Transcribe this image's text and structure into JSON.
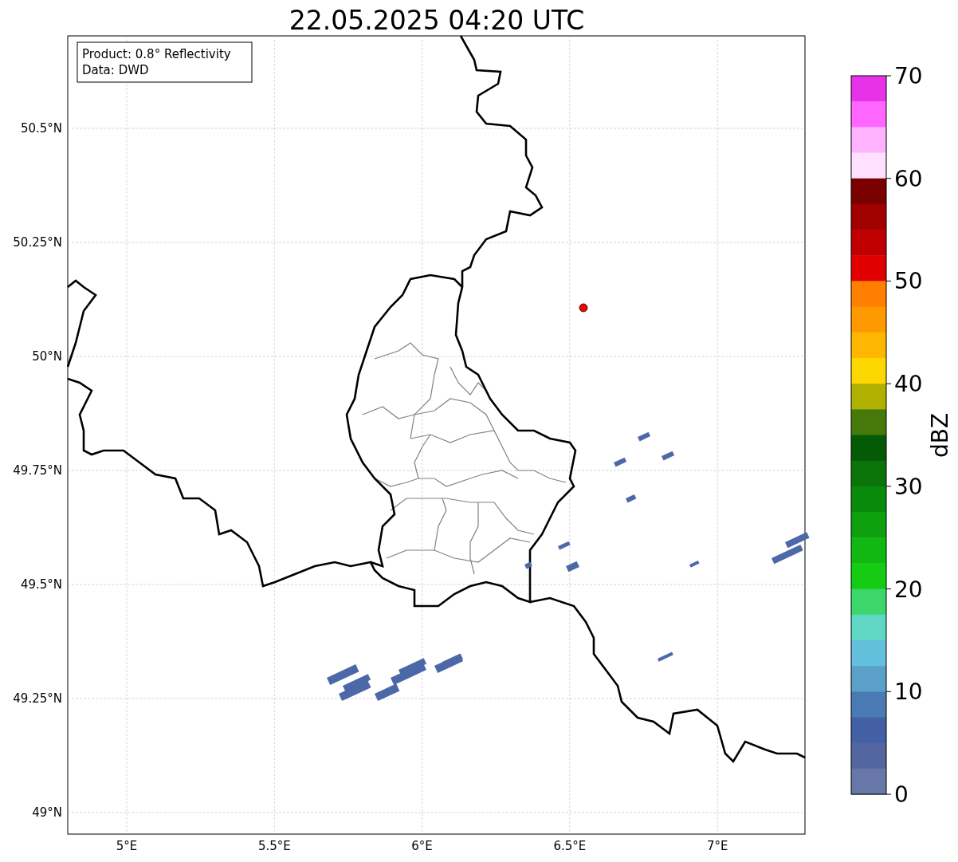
{
  "title": "22.05.2025 04:20 UTC",
  "info": [
    "Product: 0.8° Reflectivity",
    "Data: DWD"
  ],
  "map": {
    "xticks": [
      "5°E",
      "5.5°E",
      "6°E",
      "6.5°E",
      "7°E"
    ],
    "yticks": [
      "50.5°N",
      "50.25°N",
      "50°N",
      "49.75°N",
      "49.5°N",
      "49.25°N",
      "49°N"
    ]
  },
  "colorbar": {
    "label": "dBZ",
    "ticks": [
      "70",
      "60",
      "50",
      "40",
      "30",
      "20",
      "10",
      "0"
    ],
    "bins": [
      {
        "color": "#e832e8"
      },
      {
        "color": "#ff66ff"
      },
      {
        "color": "#ffb3ff"
      },
      {
        "color": "#ffe0ff"
      },
      {
        "color": "#7a0000"
      },
      {
        "color": "#a00000"
      },
      {
        "color": "#c00000"
      },
      {
        "color": "#e00000"
      },
      {
        "color": "#ff8000"
      },
      {
        "color": "#ff9900"
      },
      {
        "color": "#ffb600"
      },
      {
        "color": "#ffd700"
      },
      {
        "color": "#b0b000"
      },
      {
        "color": "#457a0a"
      },
      {
        "color": "#055a05"
      },
      {
        "color": "#0a740a"
      },
      {
        "color": "#0a8a0a"
      },
      {
        "color": "#0ea00e"
      },
      {
        "color": "#12b812"
      },
      {
        "color": "#14cc14"
      },
      {
        "color": "#3dd66b"
      },
      {
        "color": "#60d6c4"
      },
      {
        "color": "#62c0dc"
      },
      {
        "color": "#5aa0c8"
      },
      {
        "color": "#4a7ab4"
      },
      {
        "color": "#4460a4"
      },
      {
        "color": "#5466a0"
      },
      {
        "color": "#6677a8"
      }
    ]
  }
}
